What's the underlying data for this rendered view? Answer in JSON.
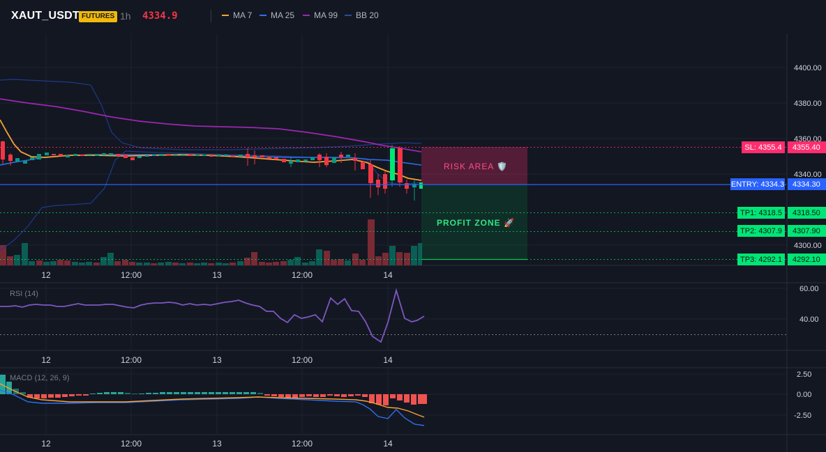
{
  "header": {
    "symbol": "XAUT_USDT",
    "market_badge": "FUTURES",
    "timeframe": "1h",
    "last_price": "4334.9",
    "indicators": [
      {
        "label": "MA 7",
        "color": "#f7a233"
      },
      {
        "label": "MA 25",
        "color": "#2f6fed"
      },
      {
        "label": "MA 99",
        "color": "#9c27b0"
      },
      {
        "label": "BB 20",
        "color": "#1e3a8a"
      }
    ]
  },
  "colors": {
    "background": "#131722",
    "up": "#089981",
    "down": "#f23645",
    "stop_loss": "#ff2d6f",
    "entry": "#2962ff",
    "take_profit": "#00c853"
  },
  "time_axis": [
    "12",
    "12:00",
    "13",
    "12:00",
    "14"
  ],
  "main_pane": {
    "price_ticks": [
      "4400.00",
      "4380.00",
      "4360.00",
      "4340.00",
      "4300.00"
    ],
    "levels": [
      {
        "key": "sl",
        "label": "SL: 4355.4",
        "value": "4355.40"
      },
      {
        "key": "entry",
        "label": "ENTRY: 4334.3",
        "value": "4334.30"
      },
      {
        "key": "tp1",
        "label": "TP1: 4318.5",
        "value": "4318.50"
      },
      {
        "key": "tp2",
        "label": "TP2: 4307.9",
        "value": "4307.90"
      },
      {
        "key": "tp3",
        "label": "TP3: 4292.1",
        "value": "4292.10"
      }
    ],
    "risk_label": "RISK AREA 🛡️",
    "profit_label": "PROFIT ZONE 🚀"
  },
  "rsi_pane": {
    "title": "RSI (14)",
    "ticks": [
      "60.00",
      "40.00"
    ]
  },
  "macd_pane": {
    "title": "MACD (12, 26, 9)",
    "ticks": [
      "2.50",
      "0.00",
      "-2.50"
    ]
  }
}
